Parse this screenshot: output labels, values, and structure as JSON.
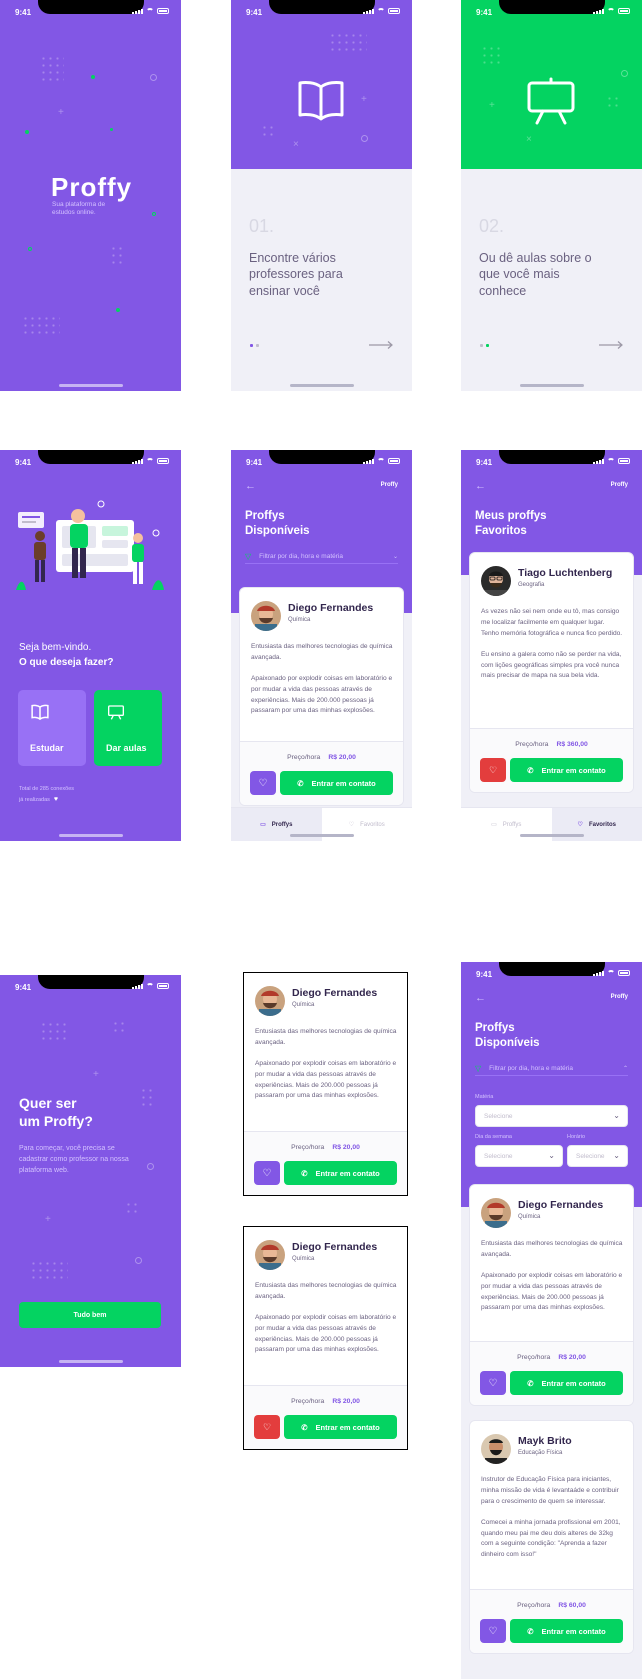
{
  "status_time": "9:41",
  "splash": {
    "logo": "Proffy",
    "tagline": "Sua plataforma de estudos online."
  },
  "onboarding": [
    {
      "number": "01.",
      "text": "Encontre vários professores para ensinar você"
    },
    {
      "number": "02.",
      "text": "Ou dê aulas sobre o que você mais conhece"
    }
  ],
  "landing": {
    "welcome_line1": "Seja bem-vindo.",
    "welcome_line2": "O que deseja fazer?",
    "study_label": "Estudar",
    "teach_label": "Dar aulas",
    "connections_line1": "Total de 285 conexões",
    "connections_line2": "já realizadas"
  },
  "list_screen": {
    "header_right": "Proffy",
    "title_line1": "Proffys",
    "title_line2": "Disponíveis",
    "filter_text": "Filtrar por dia, hora e matéria"
  },
  "favorites_screen": {
    "header_right": "Proffy",
    "title_line1": "Meus proffys",
    "title_line2": "Favoritos"
  },
  "tabs": {
    "proffys": "Proffys",
    "favoritos": "Favoritos"
  },
  "give_classes": {
    "title_line1": "Quer ser",
    "title_line2": "um Proffy?",
    "desc": "Para começar, você precisa se cadastrar como professor na nossa plataforma web.",
    "button": "Tudo bem"
  },
  "filters": {
    "subject_label": "Matéria",
    "subject_placeholder": "Selecione",
    "weekday_label": "Dia da semana",
    "weekday_placeholder": "Selecione",
    "time_label": "Horário",
    "time_placeholder": "Selecione"
  },
  "teachers": {
    "diego": {
      "name": "Diego Fernandes",
      "subject": "Química",
      "bio1": "Entusiasta das melhores tecnologias de química avançada.",
      "bio2": "Apaixonado por explodir coisas em laboratório e por mudar a vida das pessoas através de experiências. Mais de 200.000 pessoas já passaram por uma das minhas explosões.",
      "price_label": "Preço/hora",
      "price": "R$ 20,00",
      "contact": "Entrar em contato"
    },
    "tiago": {
      "name": "Tiago Luchtenberg",
      "subject": "Geografia",
      "bio1": "As vezes não sei nem onde eu tô, mas consigo me localizar facilmente em qualquer lugar. Tenho memória fotográfica e nunca fico perdido.",
      "bio2": "Eu ensino a galera como não se perder na vida, com lições geográficas simples pra você nunca mais precisar de mapa na sua bela vida.",
      "price_label": "Preço/hora",
      "price": "R$ 360,00",
      "contact": "Entrar em contato"
    },
    "mayk": {
      "name": "Mayk Brito",
      "subject": "Educação Física",
      "bio1": "Instrutor de Educação Física para iniciantes, minha missão de vida é levantaáde e contribuir para o crescimento de quem se interessar.",
      "bio2": "Comecei a minha jornada profissional em 2001, quando meu pai me deu dois alteres de 32kg com a seguinte condição: \"Aprenda a fazer dinheiro com isso!\"",
      "price_label": "Preço/hora",
      "price": "R$ 60,00",
      "contact": "Entrar em contato"
    }
  },
  "colors": {
    "primary": "#8257e5",
    "secondary": "#04d361",
    "danger": "#e33d3d",
    "background": "#f0f0f7"
  },
  "icons": [
    "book-icon",
    "easel-icon",
    "heart-icon",
    "heart-broken-icon",
    "whatsapp-icon",
    "back-arrow-icon",
    "filter-icon",
    "chevron-icon",
    "arrow-right-icon"
  ]
}
